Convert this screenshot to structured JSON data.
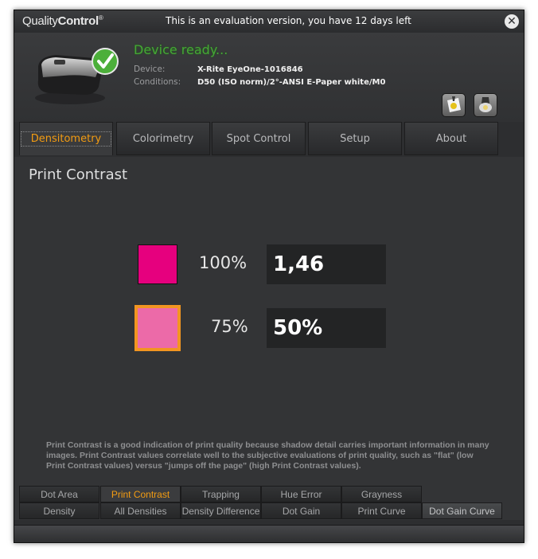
{
  "titlebar": {
    "logo_light": "Quality",
    "logo_bold": "Control",
    "logo_mark": "®",
    "eval_text": "This is an evaluation version, you have 12 days left"
  },
  "header": {
    "status": "Device ready...",
    "device_label": "Device:",
    "device_value": "X-Rite EyeOne-1016846",
    "conditions_label": "Conditions:",
    "conditions_value": "D50 (ISO norm)/2°-ANSI E-Paper white/M0",
    "icons": [
      "paper-icon",
      "light-icon"
    ]
  },
  "main_tabs": [
    {
      "label": "Densitometry",
      "active": true
    },
    {
      "label": "Colorimetry",
      "active": false
    },
    {
      "label": "Spot Control",
      "active": false
    },
    {
      "label": "Setup",
      "active": false
    },
    {
      "label": "About",
      "active": false
    }
  ],
  "content": {
    "title": "Print Contrast",
    "rows": [
      {
        "percent": "100%",
        "value": "1,46",
        "swatch_color": "#e6007e"
      },
      {
        "percent": "75%",
        "value": "50%",
        "swatch_color": "#ec6aa8",
        "highlight_color": "#f29521"
      }
    ],
    "description": "Print Contrast is a good indication of print quality because shadow detail carries important information in many images. Print Contrast values correlate well to the subjective evaluations of print quality, such as \"flat\" (low Print Contrast values) versus \"jumps off the page\" (high Print Contrast values)."
  },
  "sub_tabs_top": [
    {
      "label": "Dot Area",
      "active": false
    },
    {
      "label": "Print Contrast",
      "active": true
    },
    {
      "label": "Trapping",
      "active": false
    },
    {
      "label": "Hue Error",
      "active": false
    },
    {
      "label": "Grayness",
      "active": false
    }
  ],
  "sub_tabs_bottom": [
    {
      "label": "Density"
    },
    {
      "label": "All Densities"
    },
    {
      "label": "Density Difference"
    },
    {
      "label": "Dot Gain"
    },
    {
      "label": "Print Curve"
    },
    {
      "label": "Dot Gain Curve"
    }
  ],
  "colors": {
    "accent": "#f39c12",
    "status_green": "#46a636",
    "background": "#2d2e30"
  }
}
